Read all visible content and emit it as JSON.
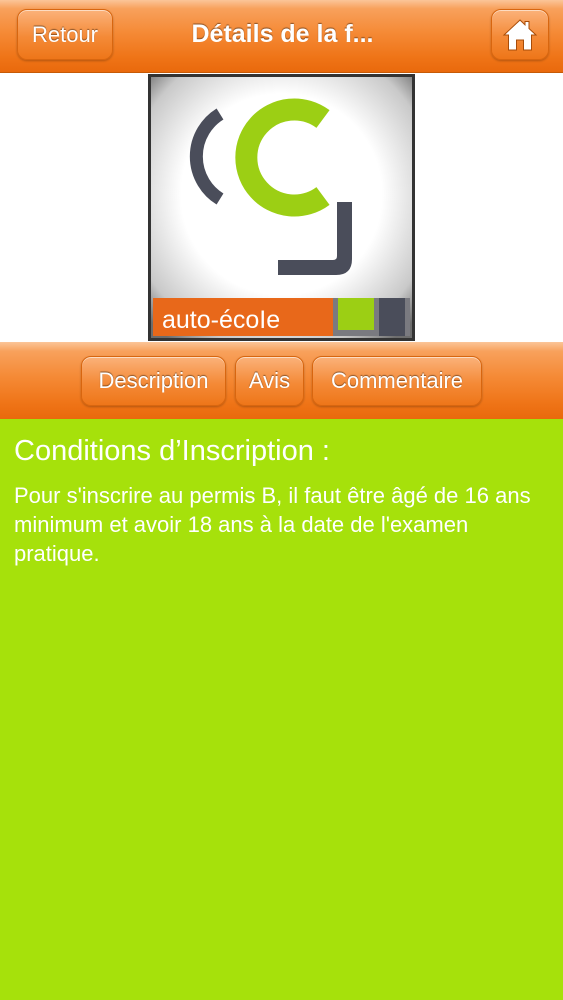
{
  "header": {
    "back_label": "Retour",
    "title": "Détails de la f...",
    "home_icon": "home-icon"
  },
  "logo": {
    "caption": "auto-écoIe",
    "colors": {
      "green": "#9ccf14",
      "dark": "#4a4d5a",
      "orange": "#e8681a"
    }
  },
  "tabs": [
    {
      "label": "Description"
    },
    {
      "label": "Avis"
    },
    {
      "label": "Commentaire"
    }
  ],
  "content": {
    "title": "Conditions d’Inscription :",
    "text": "Pour s'inscrire au permis B, il faut être âgé de 16 ans minimum et avoir 18 ans à la date de l'examen pratique."
  },
  "colors": {
    "accent": "#f0781a",
    "background": "#a6e10b"
  }
}
